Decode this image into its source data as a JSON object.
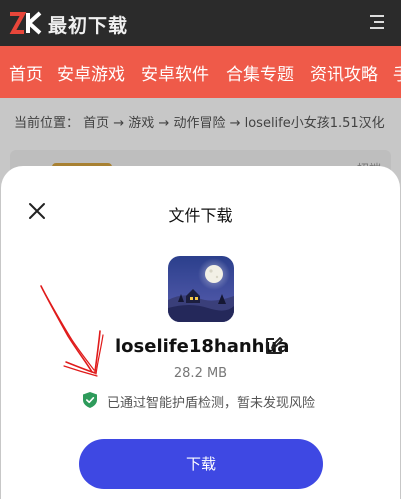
{
  "site": {
    "logo_text": "最初下载",
    "logo_mark": "ZK"
  },
  "nav": {
    "items": [
      {
        "label": "首页"
      },
      {
        "label": "安卓游戏"
      },
      {
        "label": "安卓软件"
      },
      {
        "label": "合集专题"
      },
      {
        "label": "资讯攻略"
      },
      {
        "label": "手"
      }
    ]
  },
  "breadcrumb": {
    "text": "当前位置： 首页 → 游戏 → 动作冒险 → loselife小女孩1.51汉化"
  },
  "background_card": {
    "peek_text": "招端"
  },
  "sheet": {
    "title": "文件下载",
    "file_name": "loselife18hanhua",
    "file_size": "28.2 MB",
    "safety_text": "已通过智能护盾检测，暂未发现风险",
    "download_label": "下载"
  },
  "colors": {
    "nav_bg": "#ef5a49",
    "topbar_bg": "#2b2b2b",
    "button_bg": "#3e48e3",
    "shield": "#2e9b5b",
    "annotation": "#e01b1b"
  },
  "icons": [
    "zk-logo-icon",
    "menu-icon",
    "close-icon",
    "edit-icon",
    "shield-check-icon",
    "app-icon"
  ]
}
